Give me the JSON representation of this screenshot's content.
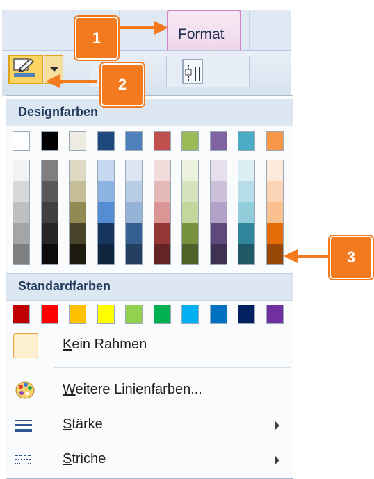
{
  "ribbon": {
    "tab_format_label": "Format"
  },
  "callouts": [
    "1",
    "2",
    "3"
  ],
  "theme_section": {
    "heading": "Designfarben",
    "base_colors": [
      "#ffffff",
      "#000000",
      "#eeece1",
      "#1f497d",
      "#4f81bd",
      "#c0504d",
      "#9bbb59",
      "#8064a2",
      "#4bacc6",
      "#f79646"
    ],
    "shade_columns": [
      [
        "#f2f2f2",
        "#d8d8d8",
        "#bfbfbf",
        "#a5a5a5",
        "#7f7f7f"
      ],
      [
        "#7f7f7f",
        "#595959",
        "#3f3f3f",
        "#262626",
        "#0c0c0c"
      ],
      [
        "#ddd9c3",
        "#c4bd97",
        "#938953",
        "#494429",
        "#1d1b10"
      ],
      [
        "#c6d9f0",
        "#8db3e2",
        "#548dd4",
        "#17365d",
        "#0f243e"
      ],
      [
        "#dbe5f1",
        "#b8cce4",
        "#95b3d7",
        "#366092",
        "#244061"
      ],
      [
        "#f2dcdb",
        "#e5b9b7",
        "#d99694",
        "#953734",
        "#632423"
      ],
      [
        "#ebf1dd",
        "#d7e3bc",
        "#c3d69b",
        "#76923c",
        "#4f6128"
      ],
      [
        "#e5e0ec",
        "#ccc1d9",
        "#b2a2c7",
        "#5f497a",
        "#3f3151"
      ],
      [
        "#dbeef3",
        "#b7dde8",
        "#92cddc",
        "#31859b",
        "#205867"
      ],
      [
        "#fdeada",
        "#fbd5b5",
        "#fac08f",
        "#e36c09",
        "#974806"
      ]
    ]
  },
  "standard_section": {
    "heading": "Standardfarben",
    "colors": [
      "#c00000",
      "#ff0000",
      "#ffc000",
      "#ffff00",
      "#92d050",
      "#00b050",
      "#00b0f0",
      "#0070c0",
      "#002060",
      "#7030a0"
    ]
  },
  "menu_items": {
    "no_border": {
      "underlined": "K",
      "rest": "ein Rahmen"
    },
    "more_colors": {
      "underlined": "W",
      "rest": "eitere Linienfarben..."
    },
    "weight": {
      "underlined": "S",
      "rest": "tärke"
    },
    "dashes": {
      "underlined": "S",
      "rest": "triche"
    }
  },
  "accent_color": "#f47a1f"
}
